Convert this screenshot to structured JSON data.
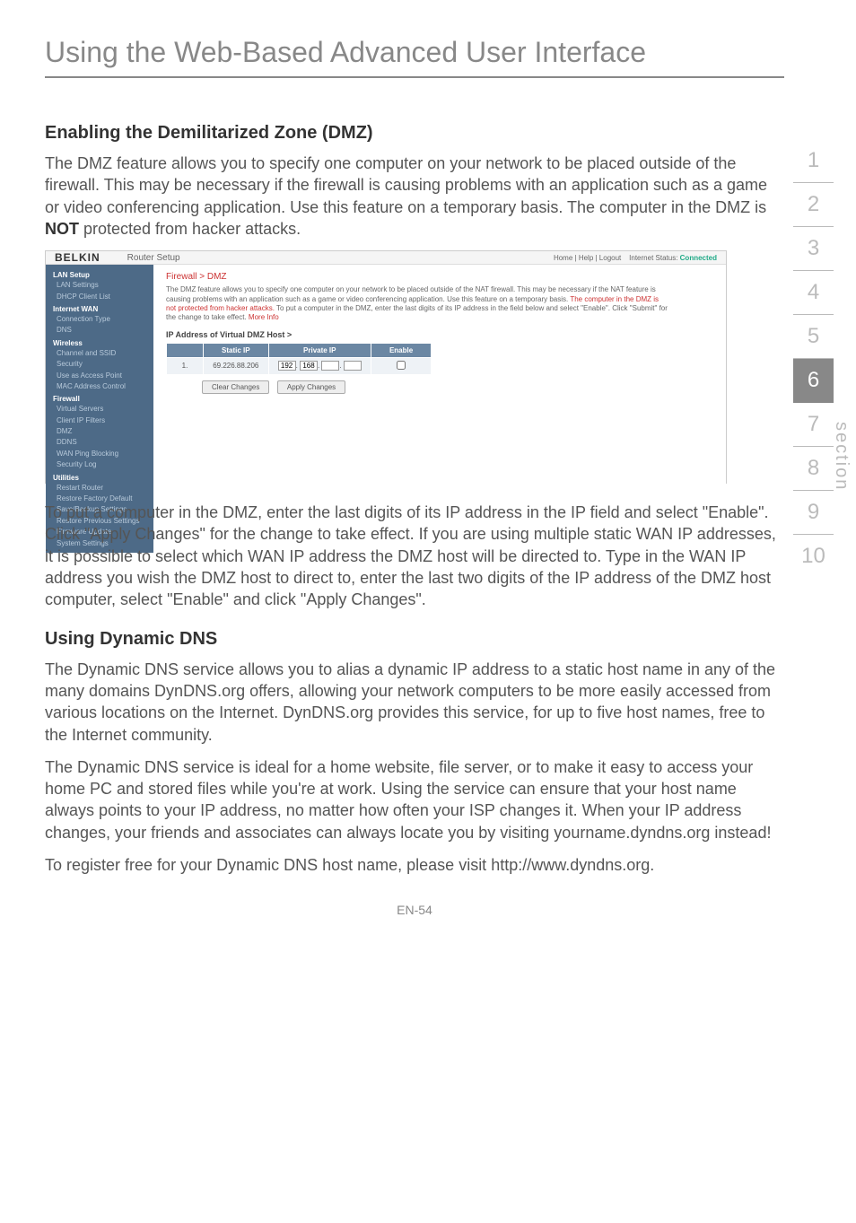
{
  "page": {
    "title": "Using the Web-Based Advanced User Interface",
    "footer": "EN-54"
  },
  "sideNav": {
    "label": "section",
    "items": [
      "1",
      "2",
      "3",
      "4",
      "5",
      "6",
      "7",
      "8",
      "9",
      "10"
    ],
    "activeIndex": 5
  },
  "sectionDMZ": {
    "heading": "Enabling the Demilitarized Zone (DMZ)",
    "intro_before": "The DMZ feature allows you to specify one computer on your network to be placed outside of the firewall. This may be necessary if the firewall is causing problems with an application such as a game or video conferencing application. Use this feature on a temporary basis. The computer in the DMZ is ",
    "intro_bold": "NOT",
    "intro_after": " protected from hacker attacks.",
    "para2": "To put a computer in the DMZ, enter the last digits of its IP address in the IP field and select \"Enable\". Click \"Apply Changes\" for the change to take effect. If you are using multiple static WAN IP addresses, it is possible to select which WAN IP address the DMZ host will be directed to. Type in the WAN IP address you wish the DMZ host to direct to, enter the last two digits of the IP address of the DMZ host computer, select \"Enable\" and click \"Apply Changes\"."
  },
  "sectionDDNS": {
    "heading": "Using Dynamic DNS",
    "para1": "The Dynamic DNS service allows you to alias a dynamic IP address to a static host name in any of the many domains DynDNS.org offers, allowing your network computers to be more easily accessed from various locations on the Internet. DynDNS.org provides this service, for up to five host names, free to the Internet community.",
    "para2": "The Dynamic DNS service is ideal for a home website, file server, or to make it easy to access your home PC and stored files while you're at work. Using the service can ensure that your host name always points to your IP address, no matter how often your ISP changes it. When your IP address changes, your friends and associates can always locate you by visiting yourname.dyndns.org instead!",
    "para3": "To register free for your Dynamic DNS host name, please visit http://www.dyndns.org."
  },
  "router": {
    "logo": "BELKIN",
    "topTitle": "Router Setup",
    "topRightLinks": "Home | Help | Logout",
    "statusLabel": "Internet Status:",
    "statusValue": "Connected",
    "breadcrumb": "Firewall > DMZ",
    "description_before": "The DMZ feature allows you to specify one computer on your network to be placed outside of the NAT firewall. This may be necessary if the NAT feature is causing problems with an application such as a game or video conferencing application. Use this feature on a temporary basis.",
    "description_warn": "The computer in the DMZ is not protected from hacker attacks.",
    "description_after": "To put a computer in the DMZ, enter the last digits of its IP address in the field below and select \"Enable\". Click \"Submit\" for the change to take effect. ",
    "moreInfo": "More Info",
    "subheading": "IP Address of Virtual DMZ Host >",
    "table": {
      "headers": {
        "staticIP": "Static IP",
        "privateIP": "Private IP",
        "enable": "Enable"
      },
      "row": {
        "index": "1.",
        "staticIP": "69.226.88.206",
        "privPrefix1": "192",
        "privPrefix2": "168",
        "privBox3": "",
        "privBox4": "",
        "enableChecked": false
      }
    },
    "buttons": {
      "clear": "Clear Changes",
      "apply": "Apply Changes"
    },
    "sidebar": [
      {
        "type": "group",
        "label": "LAN Setup"
      },
      {
        "type": "item",
        "label": "LAN Settings"
      },
      {
        "type": "item",
        "label": "DHCP Client List"
      },
      {
        "type": "group",
        "label": "Internet WAN"
      },
      {
        "type": "item",
        "label": "Connection Type"
      },
      {
        "type": "item",
        "label": "DNS"
      },
      {
        "type": "group",
        "label": "Wireless"
      },
      {
        "type": "item",
        "label": "Channel and SSID"
      },
      {
        "type": "item",
        "label": "Security"
      },
      {
        "type": "item",
        "label": "Use as Access Point"
      },
      {
        "type": "item",
        "label": "MAC Address Control"
      },
      {
        "type": "group",
        "label": "Firewall"
      },
      {
        "type": "item",
        "label": "Virtual Servers"
      },
      {
        "type": "item",
        "label": "Client IP Filters"
      },
      {
        "type": "item",
        "label": "DMZ"
      },
      {
        "type": "item",
        "label": "DDNS"
      },
      {
        "type": "item",
        "label": "WAN Ping Blocking"
      },
      {
        "type": "item",
        "label": "Security Log"
      },
      {
        "type": "group",
        "label": "Utilities"
      },
      {
        "type": "item",
        "label": "Restart Router"
      },
      {
        "type": "item",
        "label": "Restore Factory Default"
      },
      {
        "type": "item",
        "label": "Save/Backup Settings"
      },
      {
        "type": "item",
        "label": "Restore Previous Settings"
      },
      {
        "type": "item",
        "label": "Firmware Update"
      },
      {
        "type": "item",
        "label": "System Settings"
      }
    ]
  }
}
